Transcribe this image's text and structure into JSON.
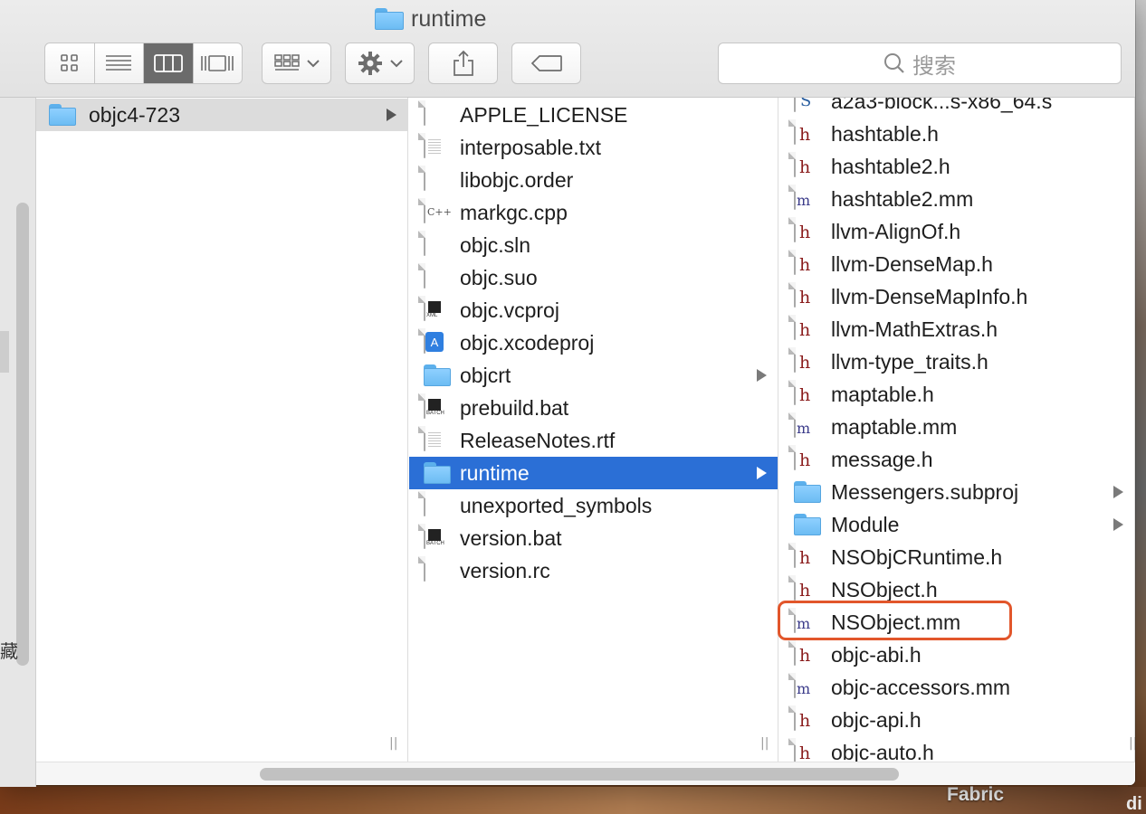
{
  "window": {
    "title": "runtime"
  },
  "toolbar": {
    "view_modes": [
      {
        "name": "view-icons-button",
        "icon": "grid-icon",
        "active": false
      },
      {
        "name": "view-list-button",
        "icon": "list-icon",
        "active": false
      },
      {
        "name": "view-columns-button",
        "icon": "columns-icon",
        "active": true
      },
      {
        "name": "view-gallery-button",
        "icon": "gallery-icon",
        "active": false
      }
    ],
    "arrange_icon": "arrange-icon",
    "action_icon": "gear-icon",
    "share_icon": "share-icon",
    "tags_icon": "tag-icon",
    "search_placeholder": "搜索"
  },
  "columns": {
    "col1": [
      {
        "name": "objc4-723",
        "type": "folder",
        "arrow": true,
        "selected": "gray"
      }
    ],
    "col2": [
      {
        "name": "APPLE_LICENSE",
        "type": "doc"
      },
      {
        "name": "interposable.txt",
        "type": "text"
      },
      {
        "name": "libobjc.order",
        "type": "doc"
      },
      {
        "name": "markgc.cpp",
        "type": "cpp"
      },
      {
        "name": "objc.sln",
        "type": "doc"
      },
      {
        "name": "objc.suo",
        "type": "doc"
      },
      {
        "name": "objc.vcproj",
        "type": "xml"
      },
      {
        "name": "objc.xcodeproj",
        "type": "xcode"
      },
      {
        "name": "objcrt",
        "type": "folder",
        "arrow": true
      },
      {
        "name": "prebuild.bat",
        "type": "batch"
      },
      {
        "name": "ReleaseNotes.rtf",
        "type": "rtf"
      },
      {
        "name": "runtime",
        "type": "folder",
        "arrow": true,
        "selected": "blue"
      },
      {
        "name": "unexported_symbols",
        "type": "doc"
      },
      {
        "name": "version.bat",
        "type": "batch"
      },
      {
        "name": "version.rc",
        "type": "doc"
      }
    ],
    "col3": [
      {
        "name": "a2a3-block...s-x86_64.s",
        "type": "s"
      },
      {
        "name": "hashtable.h",
        "type": "h"
      },
      {
        "name": "hashtable2.h",
        "type": "h"
      },
      {
        "name": "hashtable2.mm",
        "type": "mm"
      },
      {
        "name": "llvm-AlignOf.h",
        "type": "h"
      },
      {
        "name": "llvm-DenseMap.h",
        "type": "h"
      },
      {
        "name": "llvm-DenseMapInfo.h",
        "type": "h"
      },
      {
        "name": "llvm-MathExtras.h",
        "type": "h"
      },
      {
        "name": "llvm-type_traits.h",
        "type": "h"
      },
      {
        "name": "maptable.h",
        "type": "h"
      },
      {
        "name": "maptable.mm",
        "type": "mm"
      },
      {
        "name": "message.h",
        "type": "h"
      },
      {
        "name": "Messengers.subproj",
        "type": "folder",
        "arrow": true
      },
      {
        "name": "Module",
        "type": "folder",
        "arrow": true
      },
      {
        "name": "NSObjCRuntime.h",
        "type": "h"
      },
      {
        "name": "NSObject.h",
        "type": "h"
      },
      {
        "name": "NSObject.mm",
        "type": "mm",
        "highlighted": true
      },
      {
        "name": "objc-abi.h",
        "type": "h"
      },
      {
        "name": "objc-accessors.mm",
        "type": "mm"
      },
      {
        "name": "objc-api.h",
        "type": "h"
      },
      {
        "name": "objc-auto.h",
        "type": "h"
      }
    ]
  },
  "icon_marks": {
    "h": "h",
    "mm": "m",
    "s": "S",
    "cpp": "C++",
    "xml": "XML",
    "batch": "BATCH",
    "xcode": "A"
  },
  "desktop": {
    "label": "Fabric",
    "label2": "di"
  },
  "colors": {
    "selection_blue": "#2b6fd6",
    "selection_gray": "#dcdcdc",
    "highlight": "#e2562b",
    "folder": "#6cbcf3"
  }
}
